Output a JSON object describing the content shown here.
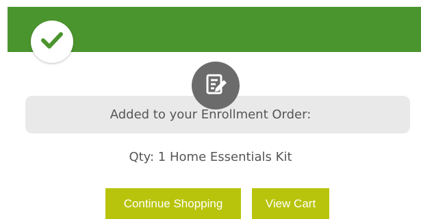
{
  "colors": {
    "header_green": "#4b952e",
    "button_lime": "#b8c40c",
    "icon_gray": "#6b6b6b",
    "box_gray": "#e9e9e9",
    "text_gray": "#555555"
  },
  "icons": {
    "success": "checkmark-icon",
    "order": "edit-document-icon"
  },
  "message": {
    "title": "Added to your Enrollment Order:"
  },
  "item": {
    "line": "Qty: 1 Home Essentials Kit"
  },
  "actions": {
    "continue_label": "Continue Shopping",
    "cart_label": "View Cart"
  }
}
